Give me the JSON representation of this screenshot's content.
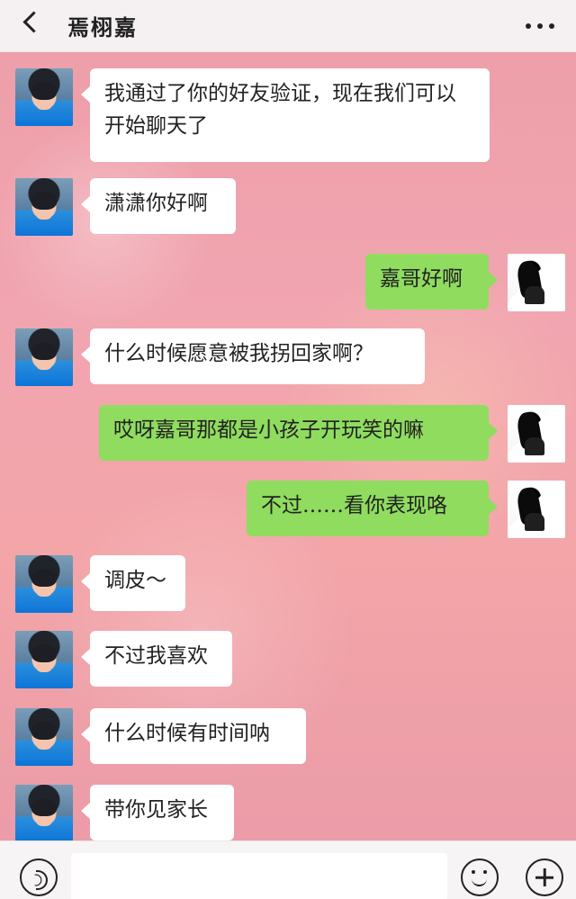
{
  "header": {
    "title": "焉栩嘉"
  },
  "messages": [
    {
      "side": "left",
      "text": "我通过了你的好友验证，现在我们可以开始聊天了"
    },
    {
      "side": "left",
      "text": "潇潇你好啊"
    },
    {
      "side": "right",
      "text": "嘉哥好啊"
    },
    {
      "side": "left",
      "text": "什么时候愿意被我拐回家啊？"
    },
    {
      "side": "right",
      "text": "哎呀嘉哥那都是小孩子开玩笑的嘛"
    },
    {
      "side": "right",
      "text": "不过……看你表现咯"
    },
    {
      "side": "left",
      "text": "调皮～"
    },
    {
      "side": "left",
      "text": "不过我喜欢"
    },
    {
      "side": "left",
      "text": "什么时候有时间呐"
    },
    {
      "side": "left",
      "text": "带你见家长"
    }
  ],
  "icons": {
    "back": "chevron-left-icon",
    "more": "more-icon",
    "voice": "voice-icon",
    "emoji": "emoji-icon",
    "plus": "plus-icon"
  },
  "colors": {
    "header_bg": "#f5f5f5",
    "left_bubble": "#ffffff",
    "right_bubble": "#8fdc5f",
    "bottom_bar": "#f6f6f6",
    "background_pink": "#f1a5b0"
  }
}
